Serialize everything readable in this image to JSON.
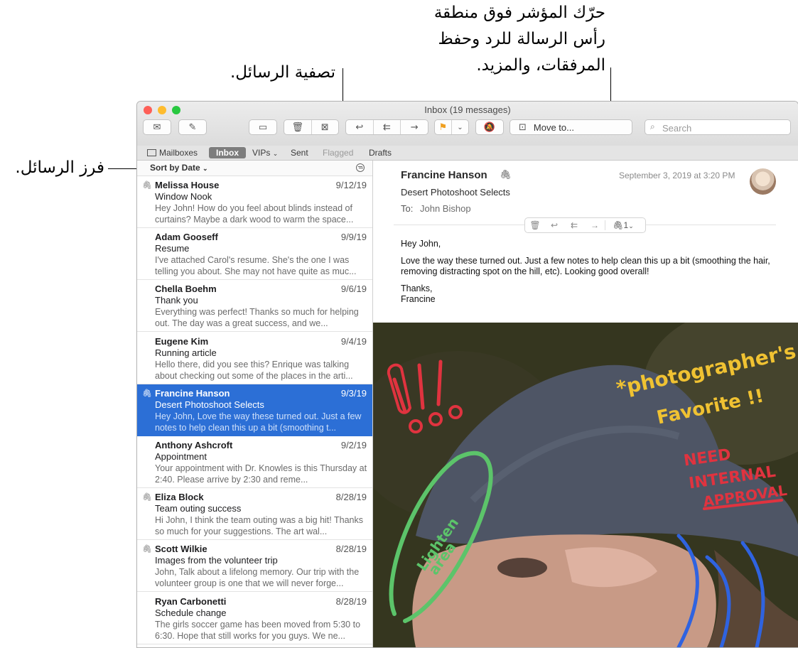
{
  "annotations": {
    "hover_line1": "حرّك المؤشر فوق منطقة",
    "hover_line2": "رأس الرسالة للرد وحفظ",
    "hover_line3": "المرفقات، والمزيد.",
    "filter": "تصفية الرسائل.",
    "sort": "فرز الرسائل."
  },
  "window": {
    "title": "Inbox (19 messages)"
  },
  "toolbar": {
    "move_to_label": "Move to...",
    "search_placeholder": "Search",
    "icons": [
      "get-mail-icon",
      "compose-icon",
      "archive-icon",
      "trash-icon",
      "junk-icon",
      "reply-icon",
      "reply-all-icon",
      "forward-icon",
      "flag-icon",
      "mute-icon",
      "move-to-icon",
      "search-icon"
    ]
  },
  "favorites": {
    "mailboxes": "Mailboxes",
    "inbox": "Inbox",
    "vips": "VIPs",
    "sent": "Sent",
    "flagged": "Flagged",
    "drafts": "Drafts"
  },
  "list": {
    "sort_label": "Sort by Date",
    "messages": [
      {
        "sender": "Melissa House",
        "date": "9/12/19",
        "subject": "Window Nook",
        "preview": "Hey John! How do you feel about blinds instead of curtains? Maybe a dark wood to warm the space...",
        "attachment": true
      },
      {
        "sender": "Adam Gooseff",
        "date": "9/9/19",
        "subject": "Resume",
        "preview": "I've attached Carol's resume. She's the one I was telling you about. She may not have quite as muc...",
        "attachment": false
      },
      {
        "sender": "Chella Boehm",
        "date": "9/6/19",
        "subject": "Thank you",
        "preview": "Everything was perfect! Thanks so much for helping out. The day was a great success, and we...",
        "attachment": false
      },
      {
        "sender": "Eugene Kim",
        "date": "9/4/19",
        "subject": "Running article",
        "preview": "Hello there, did you see this? Enrique was talking about checking out some of the places in the arti...",
        "attachment": false
      },
      {
        "sender": "Francine Hanson",
        "date": "9/3/19",
        "subject": "Desert Photoshoot Selects",
        "preview": "Hey John, Love the way these turned out. Just a few notes to help clean this up a bit (smoothing t...",
        "attachment": true
      },
      {
        "sender": "Anthony Ashcroft",
        "date": "9/2/19",
        "subject": "Appointment",
        "preview": "Your appointment with Dr. Knowles is this Thursday at 2:40. Please arrive by 2:30 and reme...",
        "attachment": false
      },
      {
        "sender": "Eliza Block",
        "date": "8/28/19",
        "subject": "Team outing success",
        "preview": "Hi John, I think the team outing was a big hit! Thanks so much for your suggestions. The art wal...",
        "attachment": true
      },
      {
        "sender": "Scott Wilkie",
        "date": "8/28/19",
        "subject": "Images from the volunteer trip",
        "preview": "John, Talk about a lifelong memory. Our trip with the volunteer group is one that we will never forge...",
        "attachment": true
      },
      {
        "sender": "Ryan Carbonetti",
        "date": "8/28/19",
        "subject": "Schedule change",
        "preview": "The girls soccer game has been moved from 5:30 to 6:30. Hope that still works for you guys. We ne...",
        "attachment": false
      }
    ]
  },
  "reader": {
    "from": "Francine Hanson",
    "date": "September 3, 2019 at 3:20 PM",
    "subject": "Desert Photoshoot Selects",
    "to_label": "To:",
    "to": "John Bishop",
    "attachment_count": "1",
    "greeting": "Hey John,",
    "body": "Love the way these turned out. Just a few notes to help clean this up a bit (smoothing the hair, removing distracting spot on the hill, etc). Looking good overall!",
    "closing": "Thanks,",
    "signature": "Francine"
  },
  "photo_markup": {
    "photographer_line1": "*photographer's",
    "photographer_line2": "Favorite !!",
    "need": "NEED",
    "internal": "INTERNAL",
    "approval": "APPROVAL",
    "lighten": "Lighten",
    "area": "area"
  },
  "colors": {
    "selection": "#2c6fd6",
    "inbox_pill": "#7d7d7d",
    "flag": "#f0a020",
    "close": "#fe5f57",
    "minimize": "#febc2e",
    "zoom": "#28c840"
  }
}
